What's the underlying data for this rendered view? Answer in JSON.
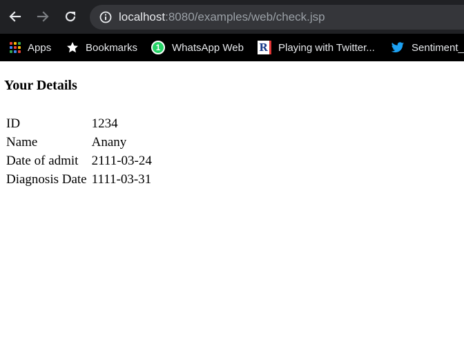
{
  "browser": {
    "url_host": "localhost",
    "url_path": ":8080/examples/web/check.jsp",
    "bookmarks": [
      {
        "label": "Apps",
        "icon": "apps-grid-icon"
      },
      {
        "label": "Bookmarks",
        "icon": "star-icon"
      },
      {
        "label": "WhatsApp Web",
        "icon": "whatsapp-icon",
        "badge": "1"
      },
      {
        "label": "Playing with Twitter...",
        "icon": "r-logo-icon"
      },
      {
        "label": "Sentiment_",
        "icon": "twitter-icon"
      }
    ]
  },
  "page": {
    "heading": "Your Details",
    "rows": [
      {
        "label": "ID",
        "value": "1234"
      },
      {
        "label": "Name",
        "value": "Anany"
      },
      {
        "label": "Date of admit",
        "value": "2111-03-24"
      },
      {
        "label": "Diagnosis Date",
        "value": "1111-03-31"
      }
    ]
  },
  "colors": {
    "toolbar": "#202124",
    "omnibox": "#35363a",
    "bookmarks_bar": "#000000",
    "twitter": "#1da1f2",
    "whatsapp": "#25d366"
  }
}
